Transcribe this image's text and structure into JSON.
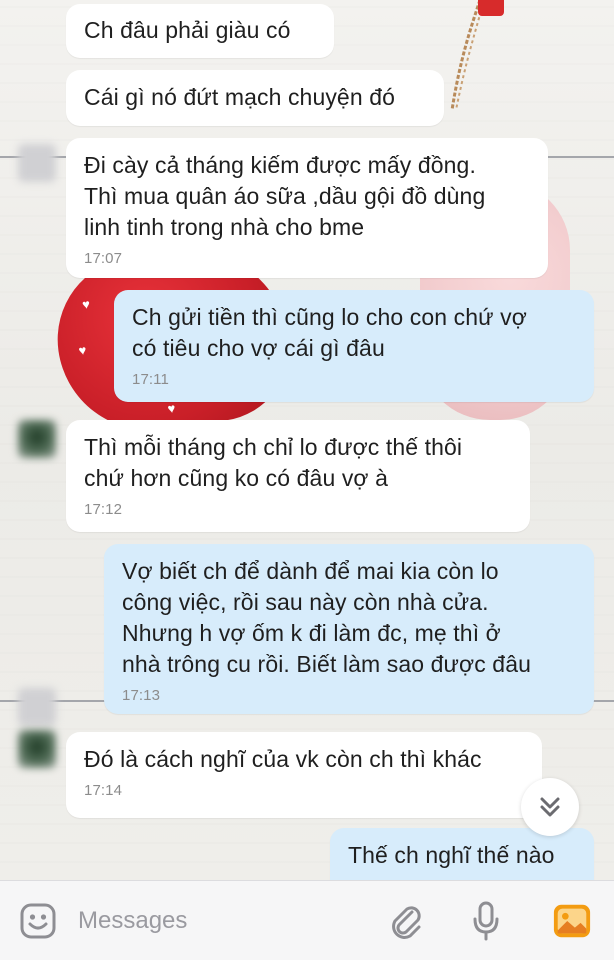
{
  "composer": {
    "placeholder": "Messages",
    "icons": [
      "emoji-icon",
      "attachment-icon",
      "microphone-icon",
      "photo-icon"
    ]
  },
  "messages": [
    {
      "side": "in",
      "text": "Ch đâu phải giàu có",
      "time": ""
    },
    {
      "side": "in",
      "text": "Cái gì nó đứt mạch chuyện đó",
      "time": ""
    },
    {
      "side": "in",
      "text": "Đi cày cả tháng kiếm được mấy đồng.\nThì mua quân áo sữa ,dầu gội đồ dùng\nlinh tinh trong nhà cho bme",
      "time": "17:07"
    },
    {
      "side": "out",
      "text": "Ch gửi tiền thì cũng lo cho con chứ vợ\ncó tiêu cho vợ cái gì đâu",
      "time": "17:11"
    },
    {
      "side": "in",
      "text": "Thì mỗi tháng ch chỉ lo được thế thôi\nchứ hơn cũng ko có đâu vợ à",
      "time": "17:12"
    },
    {
      "side": "out",
      "text": "Vợ biết ch để dành để mai kia còn lo\ncông việc, rồi sau này còn nhà cửa.\nNhưng h vợ ốm k đi làm đc, mẹ thì ở\nnhà trông cu rồi. Biết làm sao được đâu",
      "time": "17:13"
    },
    {
      "side": "in",
      "text": "Đó là cách nghĩ của vk còn ch thì khác",
      "time": "17:14"
    },
    {
      "side": "out",
      "text": "Thế ch nghĩ thế nào",
      "time": ""
    }
  ],
  "colors": {
    "incoming_bubble": "#ffffff",
    "outgoing_bubble": "#d7ecfb",
    "accent_orange": "#f39c12"
  }
}
